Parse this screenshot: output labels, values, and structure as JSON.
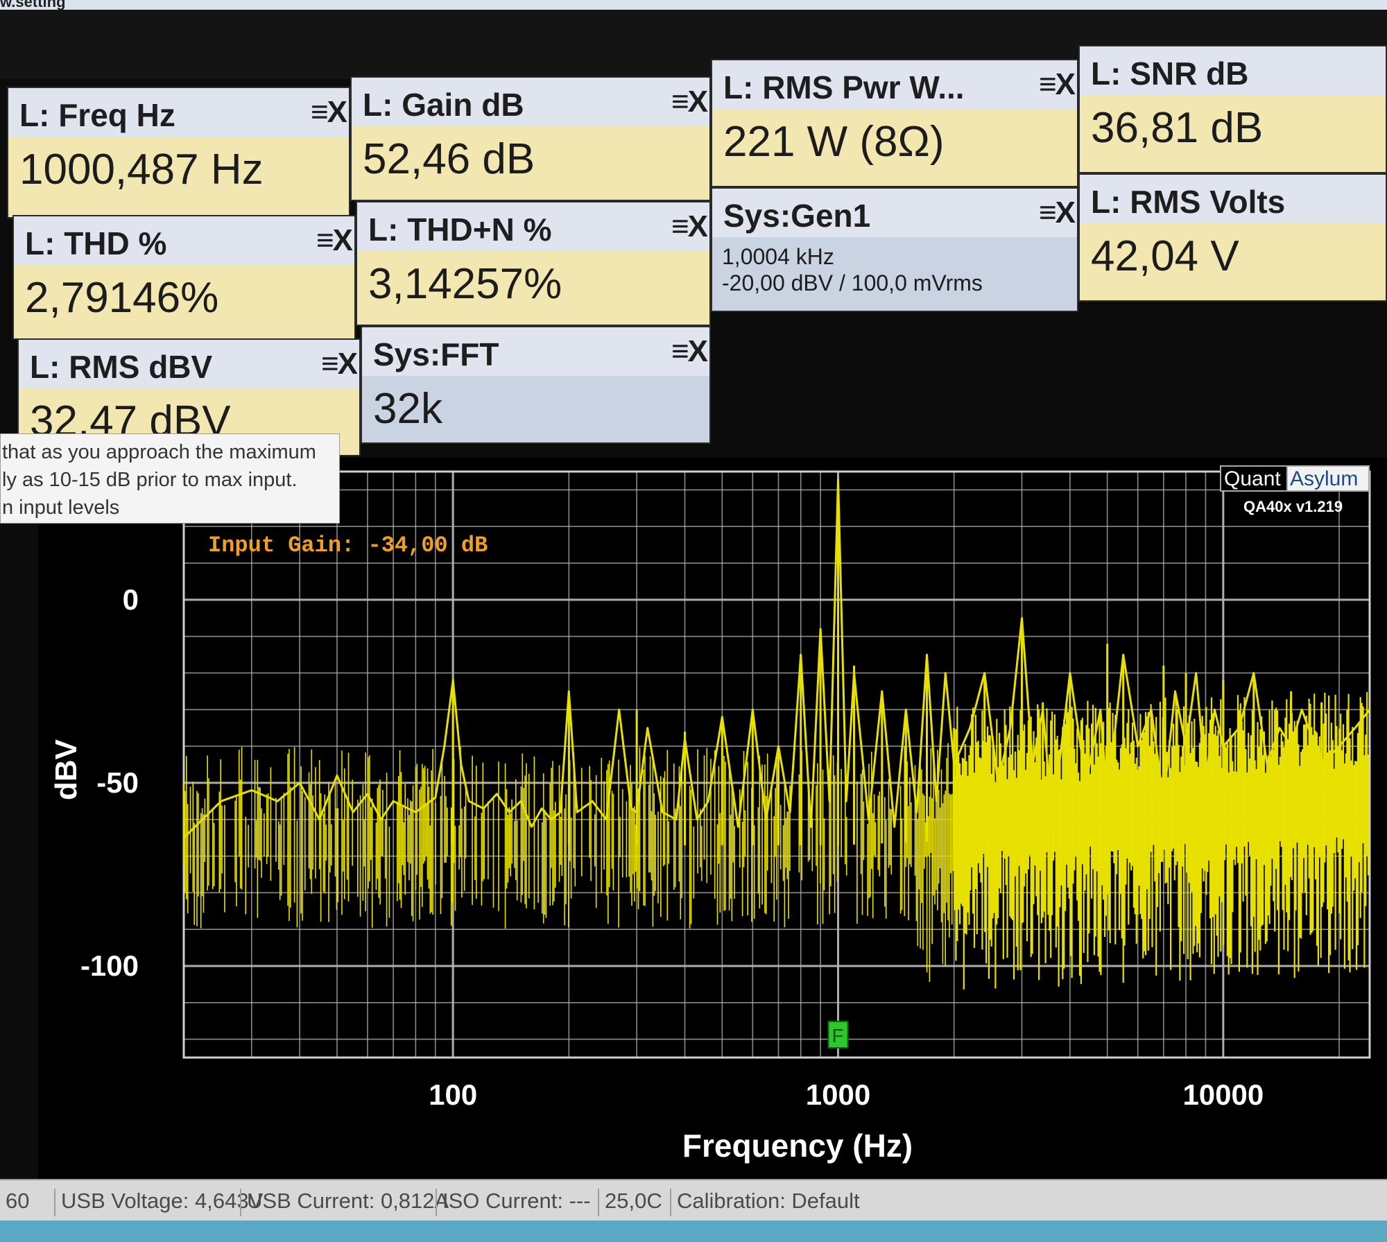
{
  "window": {
    "title_fragment": "w.setting"
  },
  "tiles": [
    {
      "id": "freq",
      "label": "L: Freq Hz",
      "value": "1000,487 Hz",
      "controls": "≡X"
    },
    {
      "id": "gain",
      "label": "L: Gain dB",
      "value": "52,46 dB",
      "controls": "≡X"
    },
    {
      "id": "rmspwr",
      "label": "L: RMS Pwr W...",
      "value": "221 W (8Ω)",
      "controls": "≡X"
    },
    {
      "id": "snr",
      "label": "L: SNR dB",
      "value": "36,81 dB"
    },
    {
      "id": "thd",
      "label": "L: THD %",
      "value": "2,79146%",
      "controls": "≡X"
    },
    {
      "id": "thdn",
      "label": "L: THD+N %",
      "value": "3,14257%",
      "controls": "≡X"
    },
    {
      "id": "gen1",
      "label": "Sys:Gen1",
      "line1": "1,0004 kHz",
      "line2": "-20,00 dBV  / 100,0 mVrms",
      "controls": "≡X"
    },
    {
      "id": "rmsvolts",
      "label": "L: RMS Volts",
      "value": "42,04 V"
    },
    {
      "id": "rmsdbv",
      "label": "L: RMS dBV",
      "value": "32,47 dBV",
      "controls": "≡X"
    },
    {
      "id": "fft",
      "label": "Sys:FFT",
      "value": "32k",
      "controls": "≡X"
    }
  ],
  "tooltip": {
    "lines": [
      "that as you approach the maximum",
      "ly as 10-15 dB prior to max input.",
      "n input levels"
    ]
  },
  "chart": {
    "overlay_text": "Input Gain: -34,00 dB",
    "brand_left": "Quant",
    "brand_right": "Asylum",
    "version": "QA40x v1.219",
    "marker_label": "F",
    "colors": {
      "trace": "#e8e000",
      "grid": "#b8b8b8",
      "overlay": "#f0a020",
      "marker": "#2ec82e"
    }
  },
  "chart_data": {
    "type": "line",
    "title": "",
    "xlabel": "Frequency (Hz)",
    "ylabel": "dBV",
    "x_scale": "log",
    "xlim": [
      20,
      24000
    ],
    "ylim": [
      -125,
      35
    ],
    "x_ticks": [
      "100",
      "1000",
      "10000"
    ],
    "x_tick_values": [
      100,
      1000,
      10000
    ],
    "y_ticks": [
      "0",
      "-50",
      "-100"
    ],
    "y_tick_values": [
      0,
      -50,
      -100
    ],
    "grid": true,
    "series": [
      {
        "values_description": "FFT spectrum",
        "x": [
          20,
          25,
          30,
          35,
          40,
          45,
          50,
          55,
          60,
          65,
          70,
          80,
          90,
          95,
          100,
          105,
          110,
          120,
          130,
          140,
          150,
          160,
          170,
          180,
          190,
          200,
          210,
          230,
          250,
          270,
          290,
          300,
          320,
          350,
          380,
          400,
          430,
          460,
          500,
          550,
          600,
          650,
          700,
          750,
          800,
          850,
          900,
          950,
          1000,
          1050,
          1100,
          1200,
          1300,
          1400,
          1500,
          1600,
          1700,
          1800,
          1900,
          2000,
          2200,
          2400,
          2600,
          2800,
          3000,
          3200,
          3400,
          3600,
          3800,
          4000,
          4400,
          4800,
          5000,
          5500,
          6000,
          6500,
          7000,
          7500,
          8000,
          8500,
          9000,
          9500,
          10000,
          11000,
          12000,
          13000,
          14000,
          15000,
          16000,
          18000,
          20000,
          22000,
          24000
        ],
        "y": [
          -65,
          -55,
          -52,
          -55,
          -50,
          -60,
          -48,
          -58,
          -53,
          -60,
          -55,
          -58,
          -54,
          -40,
          -22,
          -45,
          -55,
          -57,
          -53,
          -58,
          -55,
          -62,
          -57,
          -60,
          -58,
          -25,
          -58,
          -55,
          -60,
          -30,
          -57,
          -58,
          -35,
          -58,
          -60,
          -38,
          -60,
          -55,
          -32,
          -62,
          -30,
          -60,
          -40,
          -58,
          -15,
          -62,
          -8,
          -55,
          33,
          -55,
          -20,
          -60,
          -25,
          -62,
          -30,
          -58,
          -15,
          -55,
          -20,
          -45,
          -35,
          -20,
          -50,
          -35,
          -5,
          -45,
          -30,
          -60,
          -40,
          -20,
          -50,
          -30,
          -55,
          -15,
          -40,
          -30,
          -55,
          -25,
          -40,
          -20,
          -50,
          -30,
          -40,
          -35,
          -20,
          -45,
          -35,
          -40,
          -30,
          -45,
          -40,
          -35,
          -30
        ]
      }
    ]
  },
  "statusbar": {
    "items": [
      "60",
      "USB Voltage: 4,643V",
      "USB Current: 0,812A",
      "ISO Current: ---",
      "25,0C",
      "Calibration: Default"
    ]
  }
}
